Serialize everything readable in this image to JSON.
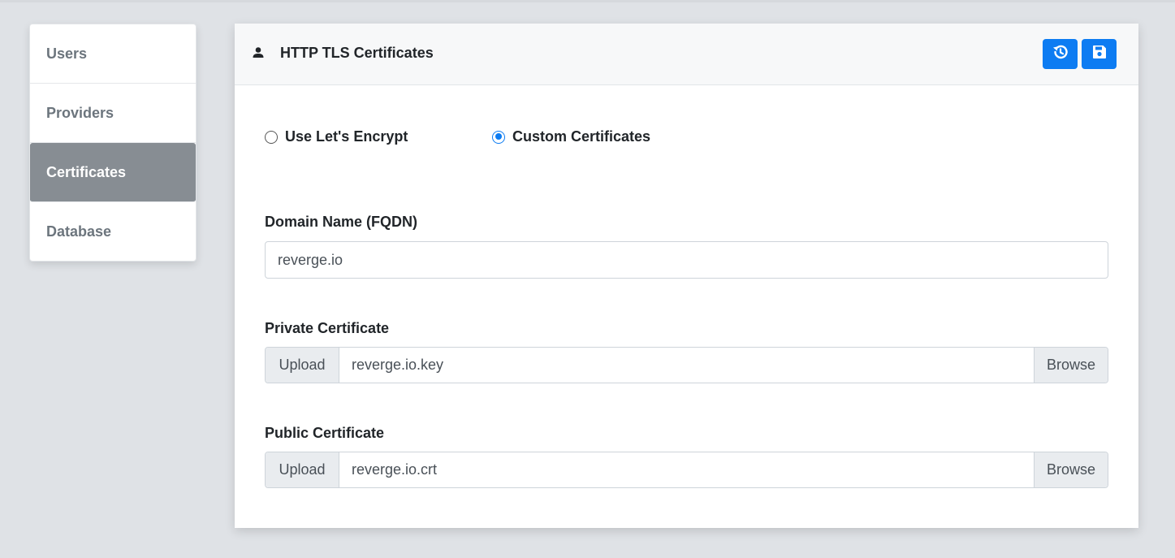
{
  "sidebar": {
    "items": [
      {
        "label": "Users"
      },
      {
        "label": "Providers"
      },
      {
        "label": "Certificates"
      },
      {
        "label": "Database"
      }
    ],
    "active": "Certificates"
  },
  "card": {
    "title": "HTTP TLS Certificates",
    "title_icon": "user-icon",
    "buttons": {
      "history_icon": "history-icon",
      "save_icon": "save-icon"
    },
    "accent_color": "#0d7cf2"
  },
  "mode": {
    "options": [
      {
        "label": "Use Let's Encrypt",
        "checked": false
      },
      {
        "label": "Custom Certificates",
        "checked": true
      }
    ]
  },
  "domain": {
    "label": "Domain Name (FQDN)",
    "value": "reverge.io"
  },
  "private_cert": {
    "label": "Private Certificate",
    "prefix": "Upload",
    "file": "reverge.io.key",
    "browse": "Browse"
  },
  "public_cert": {
    "label": "Public Certificate",
    "prefix": "Upload",
    "file": "reverge.io.crt",
    "browse": "Browse"
  }
}
